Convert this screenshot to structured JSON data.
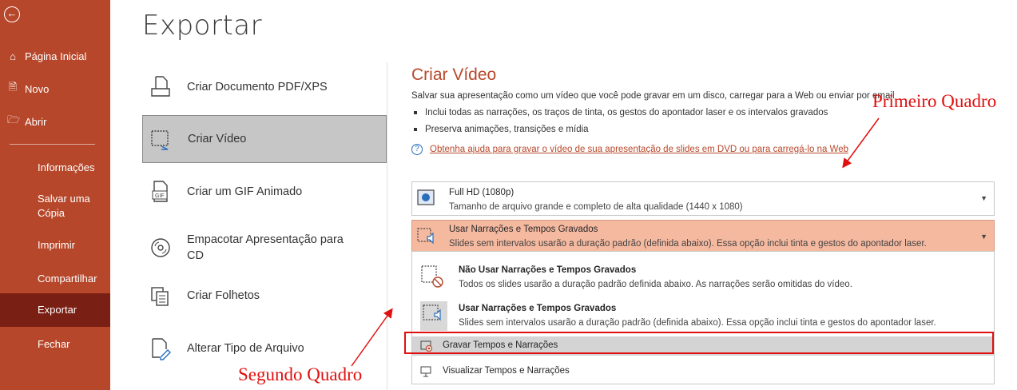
{
  "sidebar": {
    "bg": "#b7472a",
    "back_icon": "back-arrow-circle-icon",
    "top_items": [
      {
        "label": "Página Inicial",
        "icon": "home-icon"
      },
      {
        "label": "Novo",
        "icon": "new-doc-icon"
      },
      {
        "label": "Abrir",
        "icon": "folder-open-icon"
      }
    ],
    "sub_items": [
      {
        "label": "Informações"
      },
      {
        "label": "Salvar uma Cópia"
      },
      {
        "label": "Imprimir"
      },
      {
        "label": "Compartilhar"
      },
      {
        "label": "Exportar",
        "active": true
      },
      {
        "label": "Fechar"
      }
    ]
  },
  "main": {
    "title": "Exportar",
    "options": [
      {
        "label": "Criar Documento PDF/XPS",
        "icon": "pdf-doc-icon"
      },
      {
        "label": "Criar Vídeo",
        "icon": "video-icon",
        "selected": true
      },
      {
        "label": "Criar um GIF Animado",
        "icon": "gif-icon"
      },
      {
        "label": "Empacotar Apresentação para CD",
        "icon": "cd-icon"
      },
      {
        "label": "Criar Folhetos",
        "icon": "handouts-icon"
      },
      {
        "label": "Alterar Tipo de Arquivo",
        "icon": "change-file-type-icon"
      }
    ]
  },
  "panel": {
    "title": "Criar Vídeo",
    "accent": "#b7472a",
    "description": "Salvar sua apresentação como um vídeo que você pode gravar em um disco, carregar para a Web ou enviar por email",
    "bullets": [
      "Inclui todas as narrações, os traços de tinta, os gestos do apontador laser e os intervalos gravados",
      "Preserva animações, transições e mídia"
    ],
    "help_link": "Obtenha ajuda para gravar o vídeo de sua apresentação de slides em DVD ou para carregá-lo na Web",
    "quality_dropdown": {
      "title": "Full HD (1080p)",
      "subtitle": "Tamanho de arquivo grande e completo de alta qualidade (1440 x 1080)"
    },
    "narration_dropdown": {
      "title": "Usar Narrações e Tempos Gravados",
      "subtitle": "Slides sem intervalos usarão a duração padrão (definida abaixo). Essa opção inclui tinta e gestos do apontador laser.",
      "highlight": "#f5b9a0"
    },
    "menu": {
      "items": [
        {
          "title": "Não Usar Narrações e Tempos Gravados",
          "subtitle": "Todos os slides usarão a duração padrão definida abaixo. As narrações serão omitidas do vídeo."
        },
        {
          "title": "Usar Narrações e Tempos Gravados",
          "subtitle": "Slides sem intervalos usarão a duração padrão (definida abaixo). Essa opção inclui tinta e gestos do apontador laser."
        }
      ],
      "record": "Gravar Tempos e Narrações",
      "preview": "Visualizar Tempos e Narrações"
    }
  },
  "annotations": {
    "primeiro": "Primeiro Quadro",
    "segundo": "Segundo Quadro",
    "color": "#e01010"
  }
}
